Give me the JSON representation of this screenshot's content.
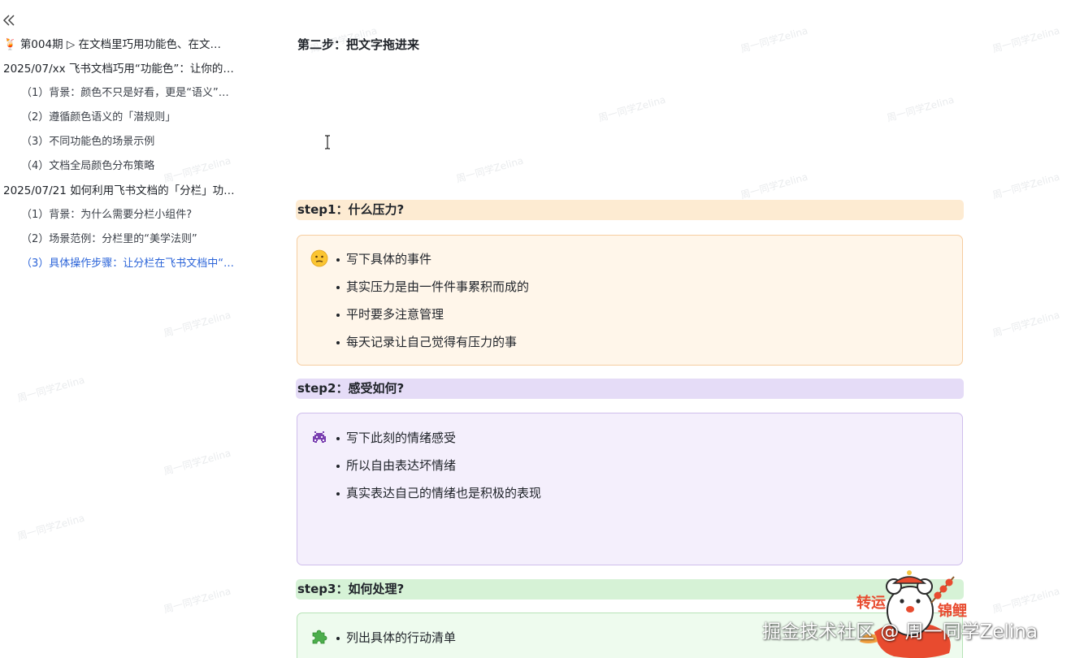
{
  "outline": {
    "items": [
      {
        "level": 1,
        "emoji": "🍹",
        "text": "第004期 ▷ 在文档里巧用功能色、在文…",
        "active": false
      },
      {
        "level": 1,
        "emoji": "",
        "text": "2025/07/xx 飞书文档巧用“功能色”：让你的…",
        "active": false
      },
      {
        "level": 2,
        "emoji": "",
        "text": "（1）背景：颜色不只是好看，更是“语义”…",
        "active": false
      },
      {
        "level": 2,
        "emoji": "",
        "text": "（2）遵循颜色语义的「潜规则」",
        "active": false
      },
      {
        "level": 2,
        "emoji": "",
        "text": "（3）不同功能色的场景示例",
        "active": false
      },
      {
        "level": 2,
        "emoji": "",
        "text": "（4）文档全局颜色分布策略",
        "active": false
      },
      {
        "level": 1,
        "emoji": "",
        "text": "2025/07/21 如何利用飞书文档的「分栏」功…",
        "active": false
      },
      {
        "level": 2,
        "emoji": "",
        "text": "（1）背景：为什么需要分栏小组件?",
        "active": false
      },
      {
        "level": 2,
        "emoji": "",
        "text": "（2）场景范例：分栏里的“美学法则”",
        "active": false
      },
      {
        "level": 2,
        "emoji": "",
        "text": "（3）具体操作步骤：让分栏在飞书文档中“…",
        "active": true
      }
    ]
  },
  "main": {
    "heading": "第二步：把文字拖进来",
    "steps": [
      {
        "title": "step1：什么压力?",
        "color": "orange",
        "icon": "confused-face-icon",
        "bullets": [
          "写下具体的事件",
          "其实压力是由一件件事累积而成的",
          "平时要多注意管理",
          "每天记录让自己觉得有压力的事"
        ]
      },
      {
        "title": "step2：感受如何?",
        "color": "purple",
        "icon": "space-invader-icon",
        "bullets": [
          "写下此刻的情绪感受",
          "所以自由表达坏情绪",
          "真实表达自己的情绪也是积极的表现"
        ]
      },
      {
        "title": "step3：如何处理?",
        "color": "green",
        "icon": "puzzle-piece-icon",
        "bullets": [
          "列出具体的行动清单"
        ]
      }
    ]
  },
  "watermark": {
    "text": "周一同学Zelina"
  },
  "brand": {
    "text": "掘金技术社区 @ 周一同学Zelina",
    "sticker_left": "转运",
    "sticker_right": "锦鲤"
  },
  "colors": {
    "accent_link": "#2a63d8",
    "orange_header": "#fdebd2",
    "purple_header": "#e5dcf7",
    "green_header": "#d6f2d6"
  }
}
